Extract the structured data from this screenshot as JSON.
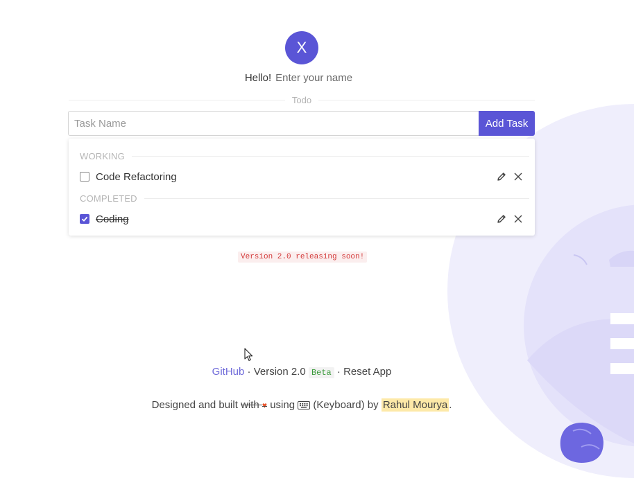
{
  "profile": {
    "avatar_letter": "X",
    "greeting": "Hello!",
    "name_placeholder": "Enter your name"
  },
  "divider": {
    "label": "Todo"
  },
  "task_form": {
    "placeholder": "Task Name",
    "add_label": "Add Task"
  },
  "sections": {
    "working": {
      "title": "WORKING",
      "tasks": [
        {
          "label": "Code Refactoring",
          "completed": false
        }
      ]
    },
    "completed": {
      "title": "COMPLETED",
      "tasks": [
        {
          "label": "Coding",
          "completed": true
        }
      ]
    }
  },
  "notice": "Version 2.0 releasing soon!",
  "footer": {
    "github_label": "GitHub",
    "separator": "·",
    "version": "Version 2.0",
    "beta": "Beta",
    "reset_label": "Reset App"
  },
  "credits": {
    "prefix": "Designed and built",
    "with": "with",
    "heart": "♥",
    "using": "using",
    "keyboard": "(Keyboard) by",
    "author": "Rahul Mourya",
    "suffix": "."
  },
  "icons": {
    "edit": "pencil-icon",
    "delete": "close-icon",
    "keyboard": "keyboard-icon",
    "cursor": "mouse-cursor-icon"
  },
  "colors": {
    "accent": "#5a55d6",
    "illustration": "#ebeafb",
    "notice_text": "#d33a3a",
    "beta_text": "#3a9a3a",
    "author_highlight": "#fde9a8"
  }
}
